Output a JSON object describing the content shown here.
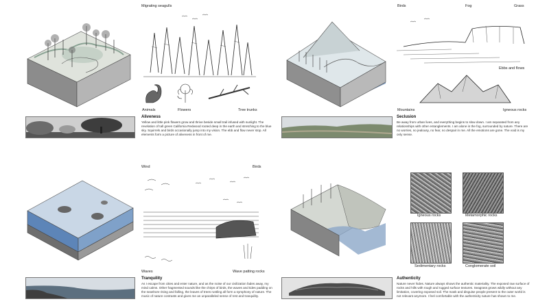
{
  "q1": {
    "labels": {
      "gulls": "Migrating seagulls",
      "animals": "Animals",
      "flowers": "Flowers",
      "trunks": "Tree trunks"
    },
    "title": "Aliveness",
    "text": "Yellow and little pink flowers grow and thrive beside small trail infused with sunlight. The revelation of tall green California Redwood rooted deep in the earth and stretching to the blue sky. Squirrels and birds occasionally jump into my vision. The ebb and flow never stop. All elements form a picture of aliveness in front of me."
  },
  "q2": {
    "labels": {
      "birds": "Birds",
      "fog": "Fog",
      "grass": "Grass",
      "ebb": "Ebbs and flows",
      "mountains": "Mountains",
      "igneous": "Igneous rocks"
    },
    "title": "Seclusion",
    "text": "Be away from urban lives, and everything begins to slow down. I am separated from any relationships with other entanglements. I am alone in the fog, surrounded by nature. There are no worries, no jealousy, no fear, no despair in me. All the emotions are gone. The void is my only sense."
  },
  "q3": {
    "labels": {
      "wind": "Wind",
      "birds": "Birds",
      "waves": "Waves",
      "patting": "Wave patting rocks"
    },
    "title": "Tranquility",
    "text": "As I escape from cities and enter nature, and as the noise of our civilization fades away, my mind calms. Other fragmented sounds like the chirps of birds, the waves and tides padding on the seashore rising and falling, the leaves of trees rustling all form a symphony of nature. The music of nature contrasts and gives me an unparalleled sense of rest and tranquility."
  },
  "q4": {
    "rocks": [
      "Igneous rocks",
      "Metamorphic rocks",
      "Sedimentary rocks",
      "Conglomerate soil"
    ],
    "title": "Authenticity",
    "text": "Nature never hides. Nature always shows the authentic materiality. The exposed raw surface of rocks and hills with rough and rugged surface textures. Seagrass grows wildly without any limitation, covering exposed soil. The mask and disguise people present to the outer world is not relevant anymore. I feel comfortable with the authenticity nature has shown to me."
  }
}
